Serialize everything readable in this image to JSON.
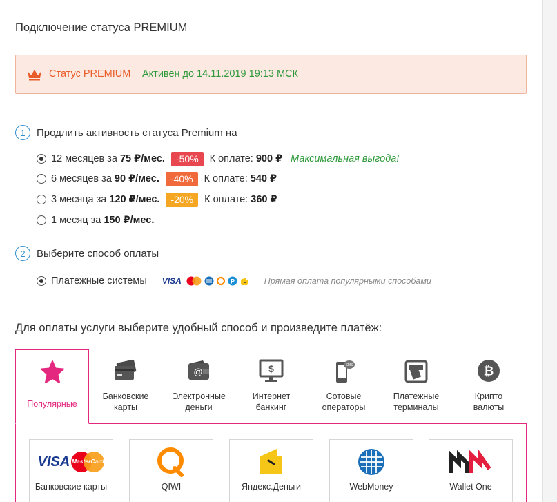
{
  "title": "Подключение статуса PREMIUM",
  "status": {
    "label": "Статус PREMIUM",
    "active": "Активен до 14.11.2019 19:13 МСК"
  },
  "step1": {
    "number": "1",
    "title": "Продлить активность статуса Premium на",
    "options": [
      {
        "prefix": "12 месяцев за ",
        "price": "75 ₽/мес.",
        "discount": "-50%",
        "discount_color": "#e8474f",
        "pay_label": "К оплате: ",
        "pay_value": "900 ₽",
        "note": "Максимальная выгода!",
        "selected": true
      },
      {
        "prefix": "6 месяцев за ",
        "price": "90 ₽/мес.",
        "discount": "-40%",
        "discount_color": "#f06a3c",
        "pay_label": "К оплате: ",
        "pay_value": "540 ₽",
        "selected": false
      },
      {
        "prefix": "3 месяца за ",
        "price": "120 ₽/мес.",
        "discount": "-20%",
        "discount_color": "#f5a623",
        "pay_label": "К оплате: ",
        "pay_value": "360 ₽",
        "selected": false
      },
      {
        "prefix": "1 месяц за ",
        "price": "150 ₽/мес.",
        "selected": false
      }
    ]
  },
  "step2": {
    "number": "2",
    "title": "Выберите способ оплаты",
    "method": "Платежные системы",
    "icons": {
      "visa": "VISA"
    },
    "note": "Прямая оплата популярными способами"
  },
  "section_heading": "Для оплаты услуги выберите удобный способ и произведите платёж:",
  "tabs": [
    {
      "label": "Популярные",
      "icon": "star-icon",
      "active": true
    },
    {
      "label": "Банковские\nкарты",
      "icon": "bank-card-icon"
    },
    {
      "label": "Электронные\nденьги",
      "icon": "wallet-icon"
    },
    {
      "label": "Интернет\nбанкинг",
      "icon": "monitor-icon"
    },
    {
      "label": "Сотовые\nоператоры",
      "icon": "phone-icon"
    },
    {
      "label": "Платежные\nтерминалы",
      "icon": "terminal-icon"
    },
    {
      "label": "Крипто\nвалюты",
      "icon": "bitcoin-icon"
    }
  ],
  "cards": [
    {
      "name": "Банковские карты",
      "logo_text": "VISA",
      "mc_text": "MasterCard"
    },
    {
      "name": "QIWI"
    },
    {
      "name": "Яндекс.Деньги"
    },
    {
      "name": "WebMoney"
    },
    {
      "name": "Wallet One"
    }
  ],
  "colors": {
    "accent": "#e4287f",
    "status_bg": "#fce9e2",
    "status_orange": "#e85d2a",
    "green": "#2f9a3b",
    "step_blue": "#2e8fce"
  }
}
